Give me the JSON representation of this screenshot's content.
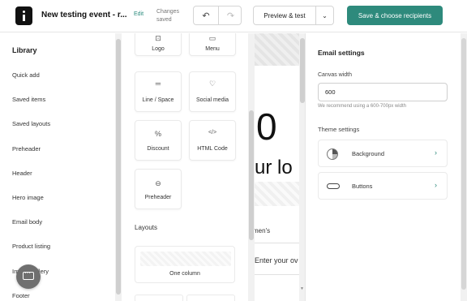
{
  "header": {
    "title": "New testing event - r...",
    "edit_label": "Edit",
    "saved_line1": "Changes",
    "saved_line2": "saved",
    "undo_icon": "↶",
    "redo_icon": "↷",
    "preview_label": "Preview & test",
    "preview_dropdown_icon": "⌄",
    "cta_label": "Save & choose recipients",
    "accent_color": "#2e8a7c"
  },
  "library": {
    "title": "Library",
    "items": [
      "Quick add",
      "Saved items",
      "Saved layouts",
      "Preheader",
      "Header",
      "Hero image",
      "Email body",
      "Product listing",
      "Image gallery",
      "Footer"
    ]
  },
  "blocks": {
    "tiles": [
      {
        "label": "Logo",
        "icon": "⊡"
      },
      {
        "label": "Menu",
        "icon": "▭"
      },
      {
        "label": "Line / Space",
        "icon": "═"
      },
      {
        "label": "Social media",
        "icon": "♡"
      },
      {
        "label": "Discount",
        "icon": "%"
      },
      {
        "label": "HTML Code",
        "icon": "</>"
      },
      {
        "label": "Preheader",
        "icon": "⊖"
      }
    ],
    "layouts_heading": "Layouts",
    "layout_one_column": "One column"
  },
  "canvas": {
    "big_text": "0",
    "mid_text": "ur lo",
    "small_text": "men's",
    "input_text": "Enter your ov"
  },
  "settings": {
    "title": "Email settings",
    "canvas_width_label": "Canvas width",
    "canvas_width_value": "600",
    "canvas_width_hint": "We recommend using a 600-700px width",
    "theme_label": "Theme settings",
    "rows": [
      {
        "label": "Background",
        "icon": "background-icon"
      },
      {
        "label": "Buttons",
        "icon": "buttons-icon"
      }
    ],
    "chevron": "›"
  }
}
